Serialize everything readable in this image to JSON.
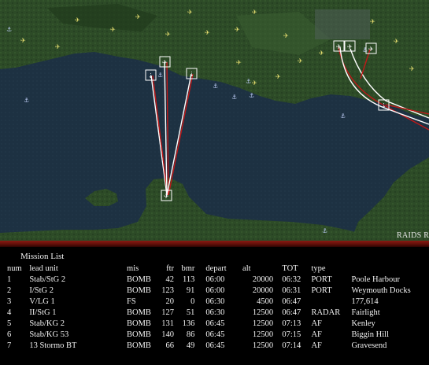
{
  "map": {
    "corner_label": "RAIDS R",
    "colors": {
      "sea": "#1c3040",
      "land": "#2c4a26",
      "route_red": "#c01818",
      "route_white": "#ffffff"
    }
  },
  "mission_list": {
    "title": "Mission List",
    "ghost_text": "",
    "columns": {
      "num": "num",
      "lead_unit": "lead unit",
      "mis": "mis",
      "ftr": "ftr",
      "bmr": "bmr",
      "depart": "depart",
      "alt": "alt",
      "tot": "TOT",
      "type": "type",
      "target": ""
    },
    "rows": [
      {
        "num": "1",
        "lead_unit": "Stab/StG 2",
        "mis": "BOMB",
        "ftr": "42",
        "bmr": "113",
        "depart": "06:00",
        "alt": "20000",
        "tot": "06:32",
        "type": "PORT",
        "target": "Poole Harbour"
      },
      {
        "num": "2",
        "lead_unit": "I/StG 2",
        "mis": "BOMB",
        "ftr": "123",
        "bmr": "91",
        "depart": "06:00",
        "alt": "20000",
        "tot": "06:31",
        "type": "PORT",
        "target": "Weymouth Docks"
      },
      {
        "num": "3",
        "lead_unit": "V/LG 1",
        "mis": "FS",
        "ftr": "20",
        "bmr": "0",
        "depart": "06:30",
        "alt": "4500",
        "tot": "06:47",
        "type": "",
        "target": "177,614"
      },
      {
        "num": "4",
        "lead_unit": "II/StG 1",
        "mis": "BOMB",
        "ftr": "127",
        "bmr": "51",
        "depart": "06:30",
        "alt": "12500",
        "tot": "06:47",
        "type": "RADAR",
        "target": "Fairlight"
      },
      {
        "num": "5",
        "lead_unit": "Stab/KG 2",
        "mis": "BOMB",
        "ftr": "131",
        "bmr": "136",
        "depart": "06:45",
        "alt": "12500",
        "tot": "07:13",
        "type": "AF",
        "target": "Kenley"
      },
      {
        "num": "6",
        "lead_unit": "Stab/KG 53",
        "mis": "BOMB",
        "ftr": "140",
        "bmr": "86",
        "depart": "06:45",
        "alt": "12500",
        "tot": "07:15",
        "type": "AF",
        "target": "Biggin Hill"
      },
      {
        "num": "7",
        "lead_unit": "13 Stormo BT",
        "mis": "BOMB",
        "ftr": "66",
        "bmr": "49",
        "depart": "06:45",
        "alt": "12500",
        "tot": "07:14",
        "type": "AF",
        "target": "Gravesend"
      }
    ]
  }
}
